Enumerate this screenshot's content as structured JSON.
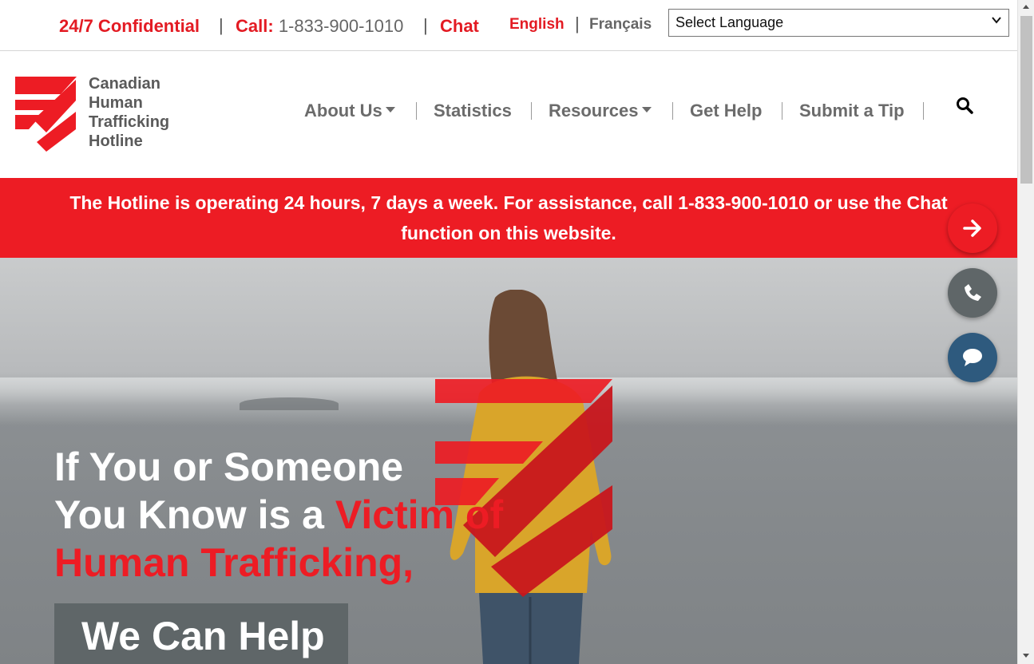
{
  "topbar": {
    "confidential": "24/7 Confidential",
    "call_label": "Call:",
    "call_number": "1-833-900-1010",
    "chat": "Chat",
    "lang_english": "English",
    "lang_french": "Français",
    "language_select": "Select Language"
  },
  "logo": {
    "line1": "Canadian",
    "line2": "Human",
    "line3": "Trafficking",
    "line4": "Hotline"
  },
  "nav": {
    "about": "About Us",
    "statistics": "Statistics",
    "resources": "Resources",
    "get_help": "Get Help",
    "submit_tip": "Submit a Tip"
  },
  "alert": {
    "line1": "The Hotline is operating 24 hours, 7 days a week. For assistance, call 1-833-900-1010 or use the Chat",
    "line2": "function on this website."
  },
  "hero": {
    "line1": "If You or Someone",
    "line2_white": "You Know is a ",
    "line2_red": "Victim of",
    "line3": "Human Trafficking,",
    "cta": "We Can Help"
  },
  "icons": {
    "search": "search-icon",
    "arrow": "arrow-right-icon",
    "phone": "phone-icon",
    "chat": "chat-bubble-icon"
  },
  "colors": {
    "brand_red": "#ed1c24",
    "nav_grey": "#6b6b6b",
    "fab_grey": "#5f6668",
    "fab_blue": "#2e5a7e"
  }
}
